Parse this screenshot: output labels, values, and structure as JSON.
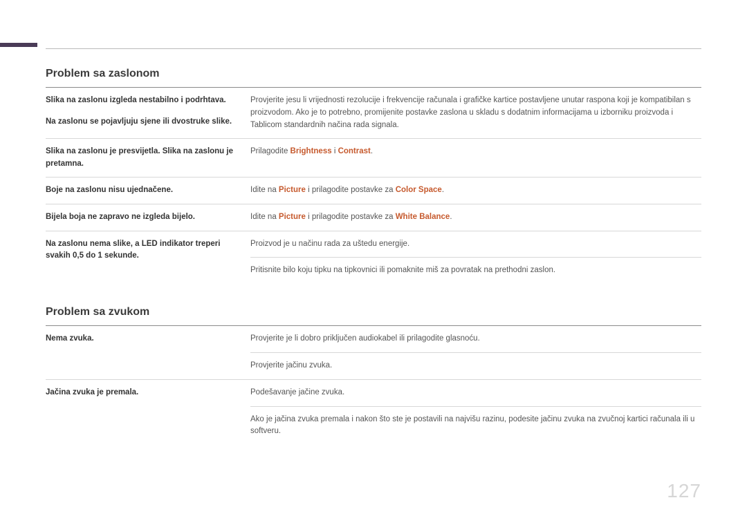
{
  "page_number": "127",
  "section_screen": {
    "title": "Problem sa zaslonom",
    "rows": [
      {
        "label": "Slika na zaslonu izgleda nestabilno i podrhtava.",
        "desc_plain": "Provjerite jesu li vrijednosti rezolucije i frekvencije računala i grafičke kartice postavljene unutar raspona koji je kompatibilan s proizvodom. Ako je to potrebno, promijenite postavke zaslona u skladu s dodatnim informacijama u izborniku proizvoda i Tablicom standardnih načina rada signala.",
        "label2": "Na zaslonu se pojavljuju sjene ili dvostruke slike."
      },
      {
        "label": "Slika na zaslonu je presvijetla. Slika na zaslonu je pretamna.",
        "desc_pre": "Prilagodite ",
        "hl1": "Brightness",
        "mid": " i ",
        "hl2": "Contrast",
        "post": "."
      },
      {
        "label": "Boje na zaslonu nisu ujednačene.",
        "desc_pre": "Idite na ",
        "hl1": "Picture",
        "mid": " i prilagodite postavke za ",
        "hl2": "Color Space",
        "post": "."
      },
      {
        "label": "Bijela boja ne zapravo ne izgleda bijelo.",
        "desc_pre": "Idite na ",
        "hl1": "Picture",
        "mid": " i prilagodite postavke za ",
        "hl2": "White Balance",
        "post": "."
      },
      {
        "label": "Na zaslonu nema slike, a LED indikator treperi svakih 0,5 do 1 sekunde.",
        "desc_plain": "Proizvod je u načinu rada za uštedu energije.",
        "desc_plain2": "Pritisnite bilo koju tipku na tipkovnici ili pomaknite miš za povratak na prethodni zaslon."
      }
    ]
  },
  "section_sound": {
    "title": "Problem sa zvukom",
    "rows": [
      {
        "label": "Nema zvuka.",
        "desc_plain": "Provjerite je li dobro priključen audiokabel ili prilagodite glasnoću.",
        "desc_plain2": "Provjerite jačinu zvuka."
      },
      {
        "label": "Jačina zvuka je premala.",
        "desc_plain": "Podešavanje jačine zvuka.",
        "desc_plain2": "Ako je jačina zvuka premala i nakon što ste je postavili na najvišu razinu, podesite jačinu zvuka na zvučnoj kartici računala ili u softveru."
      }
    ]
  }
}
